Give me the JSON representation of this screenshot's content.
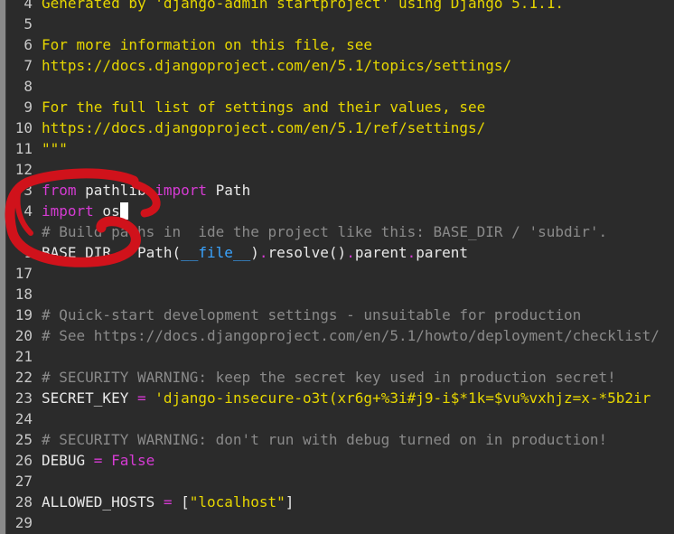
{
  "editor": {
    "lines": [
      {
        "n": "4",
        "code": [
          {
            "cls": "docstring",
            "text": "Generated by 'django-admin startproject' using Django 5.1.1."
          }
        ]
      },
      {
        "n": "5",
        "code": []
      },
      {
        "n": "6",
        "code": [
          {
            "cls": "docstring",
            "text": "For more information on this file, see"
          }
        ]
      },
      {
        "n": "7",
        "code": [
          {
            "cls": "docstring",
            "text": "https://docs.djangoproject.com/en/5.1/topics/settings/"
          }
        ]
      },
      {
        "n": "8",
        "code": []
      },
      {
        "n": "9",
        "code": [
          {
            "cls": "docstring",
            "text": "For the full list of settings and their values, see"
          }
        ]
      },
      {
        "n": "10",
        "code": [
          {
            "cls": "docstring",
            "text": "https://docs.djangoproject.com/en/5.1/ref/settings/"
          }
        ]
      },
      {
        "n": "11",
        "code": [
          {
            "cls": "docstring",
            "text": "\"\"\""
          }
        ]
      },
      {
        "n": "12",
        "code": []
      },
      {
        "n": "3",
        "code": [
          {
            "cls": "kw",
            "text": "from"
          },
          {
            "cls": "name",
            "text": " pathlib "
          },
          {
            "cls": "kw",
            "text": "import"
          },
          {
            "cls": "name",
            "text": " Path"
          }
        ]
      },
      {
        "n": "4",
        "code": [
          {
            "cls": "kw",
            "text": "import"
          },
          {
            "cls": "name",
            "text": " os"
          }
        ],
        "cursor": true
      },
      {
        "n": "",
        "code": [
          {
            "cls": "comment",
            "text": "# Build paths in  ide the project like this: BASE_DIR / 'subdir'."
          }
        ]
      },
      {
        "n": "1",
        "code": [
          {
            "cls": "name",
            "text": "BASE_DIR "
          },
          {
            "cls": "op",
            "text": "="
          },
          {
            "cls": "name",
            "text": " Path("
          },
          {
            "cls": "dunder",
            "text": "__file__"
          },
          {
            "cls": "name",
            "text": ")"
          },
          {
            "cls": "dot",
            "text": "."
          },
          {
            "cls": "name",
            "text": "resolve()"
          },
          {
            "cls": "dot",
            "text": "."
          },
          {
            "cls": "name",
            "text": "parent"
          },
          {
            "cls": "dot",
            "text": "."
          },
          {
            "cls": "name",
            "text": "parent"
          }
        ]
      },
      {
        "n": "17",
        "code": []
      },
      {
        "n": "18",
        "code": []
      },
      {
        "n": "19",
        "code": [
          {
            "cls": "comment",
            "text": "# Quick-start development settings - unsuitable for production"
          }
        ]
      },
      {
        "n": "20",
        "code": [
          {
            "cls": "comment",
            "text": "# See https://docs.djangoproject.com/en/5.1/howto/deployment/checklist/"
          }
        ]
      },
      {
        "n": "21",
        "code": []
      },
      {
        "n": "22",
        "code": [
          {
            "cls": "comment",
            "text": "# SECURITY WARNING: keep the secret key used in production secret!"
          }
        ]
      },
      {
        "n": "23",
        "code": [
          {
            "cls": "name",
            "text": "SECRET_KEY "
          },
          {
            "cls": "op",
            "text": "="
          },
          {
            "cls": "str",
            "text": " 'django-insecure-o3t(xr6g+%3i#j9-i$*1k=$vu%vxhjz=x-*5b2ir"
          }
        ]
      },
      {
        "n": "24",
        "code": []
      },
      {
        "n": "25",
        "code": [
          {
            "cls": "comment",
            "text": "# SECURITY WARNING: don't run with debug turned on in production!"
          }
        ]
      },
      {
        "n": "26",
        "code": [
          {
            "cls": "name",
            "text": "DEBUG "
          },
          {
            "cls": "op",
            "text": "="
          },
          {
            "cls": "const",
            "text": " False"
          }
        ]
      },
      {
        "n": "27",
        "code": []
      },
      {
        "n": "28",
        "code": [
          {
            "cls": "name",
            "text": "ALLOWED_HOSTS "
          },
          {
            "cls": "op",
            "text": "="
          },
          {
            "cls": "name",
            "text": " ["
          },
          {
            "cls": "str",
            "text": "\"localhost\""
          },
          {
            "cls": "name",
            "text": "]"
          }
        ]
      },
      {
        "n": "29",
        "code": []
      }
    ]
  },
  "colors": {
    "background": "#2b2b2b",
    "docstring": "#e6d600",
    "keyword": "#d53bd3",
    "comment": "#8a8a8a",
    "dunder": "#3aa4ff",
    "annotation": "#d0121b"
  },
  "icons": {
    "annotation": "red-circle-annotation"
  }
}
